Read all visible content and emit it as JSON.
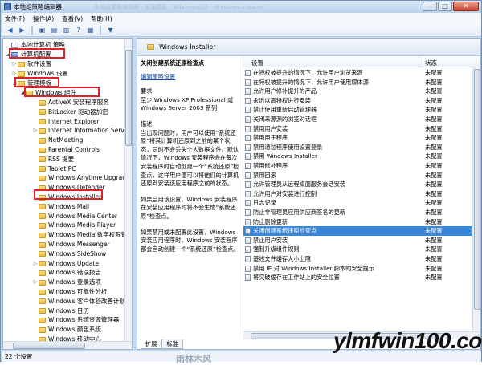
{
  "window": {
    "title": "本地组策略编辑器",
    "ghost_title": "本地组策略编辑器 - 管理模板 - Windows组件 - Windows Installer"
  },
  "menu": [
    "文件(F)",
    "操作(A)",
    "查看(V)",
    "帮助(H)"
  ],
  "tree": {
    "root": "本地计算机 策略",
    "items": [
      "计算机配置",
      "软件设置",
      "Windows 设置",
      "管理模板",
      "Windows 组件",
      "ActiveX 安装程序服务",
      "BitLocker 驱动器加密",
      "Internet Explorer",
      "Internet Information Services",
      "NetMeeting",
      "Parental Controls",
      "RSS 提要",
      "Tablet PC",
      "Windows Anytime Upgrade",
      "Windows Defender",
      "Windows Installer",
      "Windows Mail",
      "Windows Media Center",
      "Windows Media Player",
      "Windows Media 数字权限管理",
      "Windows Messenger",
      "Windows SideShow",
      "Windows Update",
      "Windows 错误报告",
      "Windows 登录选项",
      "Windows 可靠性分析",
      "Windows 客户体验改善计划",
      "Windows 日历",
      "Windows 系统资源管理器",
      "Windows 颜色系统",
      "Windows 移动中心"
    ]
  },
  "right": {
    "header": "Windows Installer",
    "desc_title": "关闭创建系统还原检查点",
    "desc_link": "编辑策略设置",
    "desc_req": "要求:",
    "desc_req_val": "至少 Windows XP Professional 或 Windows Server 2003 系列",
    "desc_label": "描述:",
    "desc_text": "当出现问题时，用户可以使用“系统还原”将其计算机还原到之前的某个状态，同时不会丢失个人数据文件。默认情况下，Windows 安装程序会在每次安装程序时自动创建一个“系统还原”检查点，这样用户便可以将他们的计算机还原到安装该应用程序之前的状态。",
    "desc_text2": "如果启用该设置，Windows 安装程序在安装应用程序时将不会生成“系统还原”检查点。",
    "desc_text3": "如果禁用或未配置此设置，Windows 安装应用程序时，Windows 安装程序都会自动创建一个“系统还原”检查点。",
    "col_setting": "设置",
    "col_state": "状态",
    "rows": [
      {
        "name": "在特权被提升的情况下，允许用户浏览来源",
        "state": "未配置"
      },
      {
        "name": "在特权被提升的情况下，允许用户使用媒体源",
        "state": "未配置"
      },
      {
        "name": "允许用户修补提升的产品",
        "state": "未配置"
      },
      {
        "name": "永远以高特权进行安装",
        "state": "未配置"
      },
      {
        "name": "禁止使用重新启动管理器",
        "state": "未配置"
      },
      {
        "name": "关闭来源源的浏览对话框",
        "state": "未配置"
      },
      {
        "name": "禁用用户安装",
        "state": "未配置"
      },
      {
        "name": "禁用用于程序",
        "state": "未配置"
      },
      {
        "name": "禁用通过程序使用设置登录",
        "state": "未配置"
      },
      {
        "name": "禁用 Windows Installer",
        "state": "未配置"
      },
      {
        "name": "禁用修补程序",
        "state": "未配置"
      },
      {
        "name": "禁用回滚",
        "state": "未配置"
      },
      {
        "name": "允许管理员从远程桌面服务会话安装",
        "state": "未配置"
      },
      {
        "name": "允许用户对安装进行控制",
        "state": "未配置"
      },
      {
        "name": "日志记录",
        "state": "未配置"
      },
      {
        "name": "防止非管理员应用供应商签名的更新",
        "state": "未配置"
      },
      {
        "name": "防止删除更新",
        "state": "未配置"
      },
      {
        "name": "关闭创建系统还原检查点",
        "state": "未配置"
      },
      {
        "name": "禁止用户安装",
        "state": "未配置"
      },
      {
        "name": "强制升级组件规则",
        "state": "未配置"
      },
      {
        "name": "基线文件缓存大小上限",
        "state": "未配置"
      },
      {
        "name": "禁用 IE 对 Windows Installer 脚本的安全提示",
        "state": "未配置"
      },
      {
        "name": "将突破缓存在工作站上的安全位置",
        "state": "未配置"
      }
    ],
    "selected_index": 17,
    "tabs": [
      "扩展",
      "标准"
    ]
  },
  "status": "22 个设置",
  "watermark": "ylmfwin100.com",
  "watermark2": "雨林木风"
}
